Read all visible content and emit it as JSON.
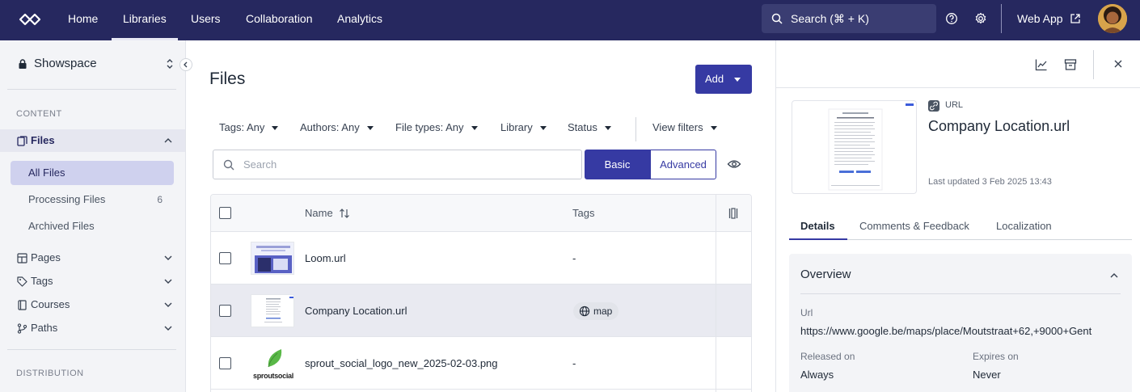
{
  "topnav": {
    "items": [
      "Home",
      "Libraries",
      "Users",
      "Collaboration",
      "Analytics"
    ],
    "search_placeholder": "Search (⌘ + K)",
    "web_app": "Web App"
  },
  "sidebar": {
    "workspace": "Showspace",
    "section_content": "CONTENT",
    "files": "Files",
    "sub_items": [
      "All Files",
      "Processing Files",
      "Archived Files"
    ],
    "processing_count": "6",
    "items": [
      "Pages",
      "Tags",
      "Courses",
      "Paths"
    ],
    "section_distribution": "DISTRIBUTION"
  },
  "main": {
    "title": "Files",
    "add_label": "Add",
    "filters": [
      "Tags: Any",
      "Authors: Any",
      "File types: Any",
      "Library",
      "Status",
      "View filters"
    ],
    "search_placeholder": "Search",
    "mode_basic": "Basic",
    "mode_advanced": "Advanced"
  },
  "table": {
    "col_name": "Name",
    "col_tags": "Tags",
    "rows": [
      {
        "name": "Loom.url",
        "tag": "-"
      },
      {
        "name": "Company Location.url",
        "tag": "map"
      },
      {
        "name": "sprout_social_logo_new_2025-02-03.png",
        "tag": "-"
      }
    ],
    "sprout_text": "sproutsocial"
  },
  "panel": {
    "type": "URL",
    "title": "Company Location.url",
    "updated": "Last updated 3 Feb 2025 13:43",
    "tabs": [
      "Details",
      "Comments & Feedback",
      "Localization"
    ],
    "overview": "Overview",
    "url_label": "Url",
    "url_value": "https://www.google.be/maps/place/Moutstraat+62,+9000+Gent",
    "released_label": "Released on",
    "released_value": "Always",
    "expires_label": "Expires on",
    "expires_value": "Never"
  },
  "colors": {
    "nav_bg": "#26285f",
    "accent": "#363aa3",
    "active_sub": "#cfd1ee"
  }
}
